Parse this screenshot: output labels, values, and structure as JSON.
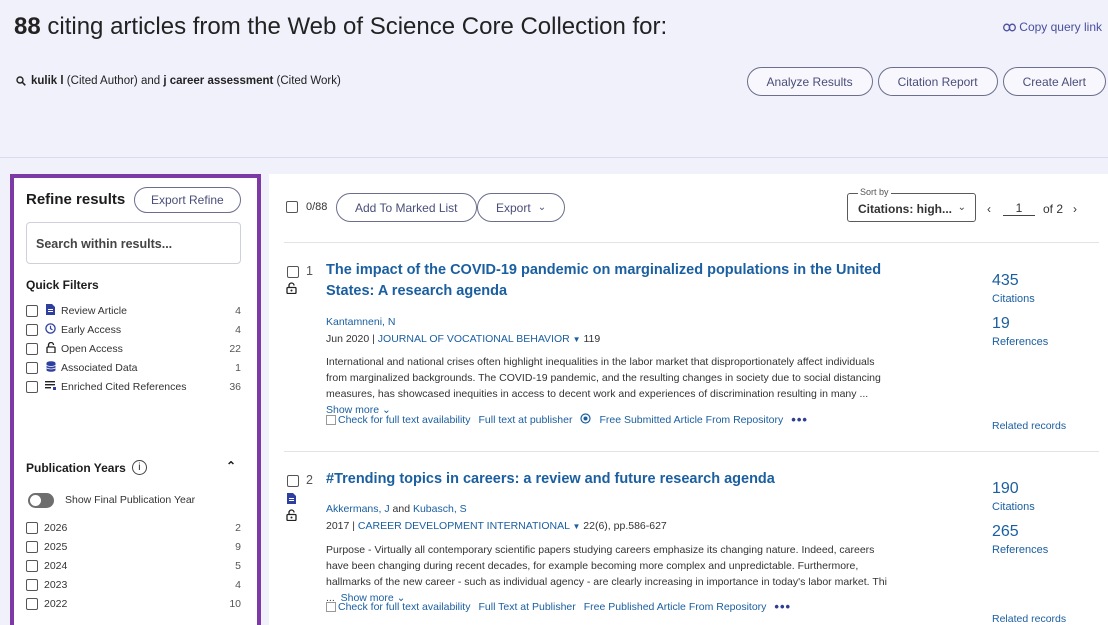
{
  "header": {
    "count": "88",
    "headline_rest": " citing articles from the Web of Science Core Collection for:",
    "copy_query_link": "Copy query link",
    "query": {
      "author": "kulik l",
      "author_field": " (Cited Author) and ",
      "work": "j career assessment",
      "work_field": " (Cited Work)"
    },
    "buttons": {
      "analyze": "Analyze Results",
      "citation_report": "Citation Report",
      "create_alert": "Create Alert"
    }
  },
  "refine": {
    "title": "Refine results",
    "export_label": "Export Refine",
    "search_placeholder": "Search within results...",
    "quick_filters_title": "Quick Filters",
    "quick_filters": [
      {
        "label": "Review Article",
        "count": "4",
        "icon": "document-icon"
      },
      {
        "label": "Early Access",
        "count": "4",
        "icon": "clock-icon"
      },
      {
        "label": "Open Access",
        "count": "22",
        "icon": "lock-open-icon"
      },
      {
        "label": "Associated Data",
        "count": "1",
        "icon": "database-icon"
      },
      {
        "label": "Enriched Cited References",
        "count": "36",
        "icon": "list-icon"
      }
    ],
    "pub_years_title": "Publication Years",
    "show_final_label": "Show Final Publication Year",
    "years": [
      {
        "label": "2026",
        "count": "2"
      },
      {
        "label": "2025",
        "count": "9"
      },
      {
        "label": "2024",
        "count": "5"
      },
      {
        "label": "2023",
        "count": "4"
      },
      {
        "label": "2022",
        "count": "10"
      }
    ]
  },
  "toolbar": {
    "selected": "0/88",
    "add_marked": "Add To Marked List",
    "export": "Export",
    "sort_legend": "Sort by",
    "sort_value": "Citations: high...",
    "page": "1",
    "of_pages": "of 2"
  },
  "records": [
    {
      "num": "1",
      "title": "The impact of the COVID-19 pandemic on marginalized populations in the United States: A research agenda",
      "author1": "Kantamneni, N",
      "author_and": "",
      "author2": "",
      "date": "Jun 2020",
      "journal": "JOURNAL OF VOCATIONAL BEHAVIOR",
      "volume": "119",
      "abstract": "International and national crises often highlight inequalities in the labor market that disproportionately affect individuals from marginalized backgrounds. The COVID-19 pandemic, and the resulting changes in society due to social distancing measures, has showcased inequities in access to decent work and experiences of discrimination resulting in many ...",
      "show_more": "Show more",
      "check_full_text": "Check for full text availability",
      "publisher_link": "Full text at publisher",
      "repo_link": "Free Submitted Article From Repository",
      "citations": "435",
      "citations_label": "Citations",
      "references": "19",
      "references_label": "References",
      "related": "Related records"
    },
    {
      "num": "2",
      "title": "#Trending topics in careers: a review and future research agenda",
      "author1": "Akkermans, J",
      "author_and": " and ",
      "author2": "Kubasch, S",
      "date": "2017",
      "journal": "CAREER DEVELOPMENT INTERNATIONAL",
      "volume": "22(6), pp.586-627",
      "abstract": "Purpose - Virtually all contemporary scientific papers studying careers emphasize its changing nature. Indeed, careers have been changing during recent decades, for example becoming more complex and unpredictable. Furthermore, hallmarks of the new career - such as individual agency - are clearly increasing in importance in today's labor market. Thi ...",
      "show_more": "Show more",
      "check_full_text": "Check for full text availability",
      "publisher_link": "Full Text at Publisher",
      "repo_link": "Free Published Article From Repository",
      "citations": "190",
      "citations_label": "Citations",
      "references": "265",
      "references_label": "References",
      "related": "Related records"
    }
  ]
}
